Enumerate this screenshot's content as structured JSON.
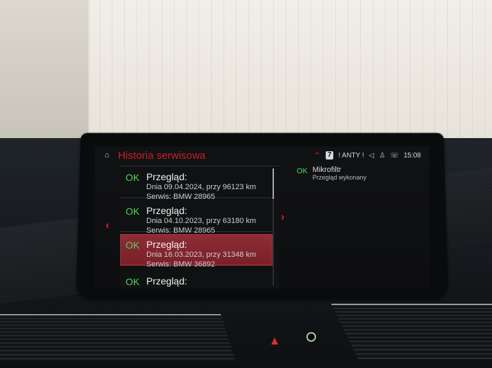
{
  "header": {
    "title": "Historia serwisowa",
    "badge_number": "7",
    "status_text": "! ANTY !",
    "time": "15:08"
  },
  "list_items": [
    {
      "ok": "OK",
      "label": "Przegląd:",
      "detail": "Dnia 09.04.2024, przy 96123 km",
      "service": "Serwis: BMW 28965"
    },
    {
      "ok": "OK",
      "label": "Przegląd:",
      "detail": "Dnia 04.10.2023, przy 63180 km",
      "service": "Serwis: BMW 28965"
    },
    {
      "ok": "OK",
      "label": "Przegląd:",
      "detail": "Dnia 16.03.2023, przy 31348 km",
      "service": "Serwis: BMW 36892"
    },
    {
      "ok": "OK",
      "label": "Przegląd:"
    }
  ],
  "detail_panel": {
    "ok": "OK",
    "title": "Mikrofiltr",
    "subtitle": "Przegląd wykonany"
  },
  "icons": {
    "home": "home-icon",
    "left": "chevron-left-icon",
    "right": "chevron-right-icon",
    "up": "chevron-up-icon",
    "mute": "speaker-muted-icon",
    "user": "user-icon",
    "phone": "phone-icon",
    "hazard": "hazard-triangle-icon"
  },
  "colors": {
    "accent_red": "#d11d22",
    "ok_green": "#4ed85d",
    "selected_row": "#7a1f29"
  }
}
